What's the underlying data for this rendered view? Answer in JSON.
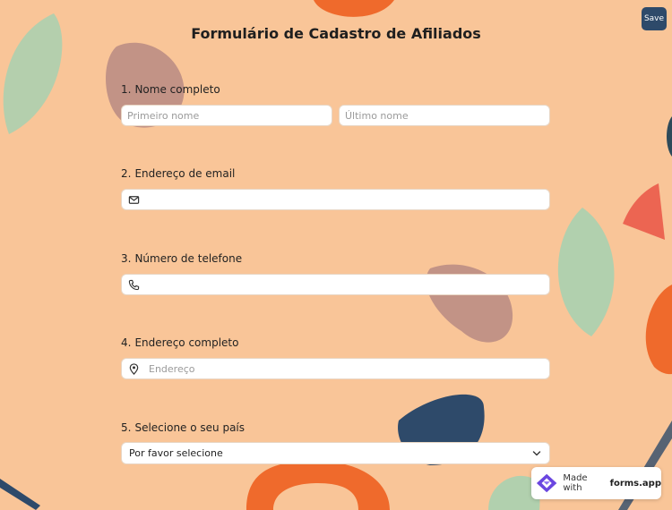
{
  "form": {
    "title": "Formulário de Cadastro de Afiliados",
    "save_label": "Save",
    "questions": [
      {
        "number": "1.",
        "label": "Nome completo",
        "first_placeholder": "Primeiro nome",
        "last_placeholder": "Último nome"
      },
      {
        "number": "2.",
        "label": "Endereço de email",
        "icon": "envelope-icon",
        "placeholder": ""
      },
      {
        "number": "3.",
        "label": "Número de telefone",
        "icon": "phone-icon",
        "placeholder": ""
      },
      {
        "number": "4.",
        "label": "Endereço completo",
        "icon": "map-pin-icon",
        "placeholder": "Endereço"
      },
      {
        "number": "5.",
        "label": "Selecione o seu país",
        "selected": "Por favor selecione",
        "icon": "chevron-down-icon"
      }
    ]
  },
  "badge": {
    "prefix": "Made with",
    "brand": "forms.app",
    "icon": "forms-app-logo-icon"
  },
  "colors": {
    "background": "#f9c598",
    "save_button": "#2e4a6a",
    "field_bg": "#ffffff"
  }
}
